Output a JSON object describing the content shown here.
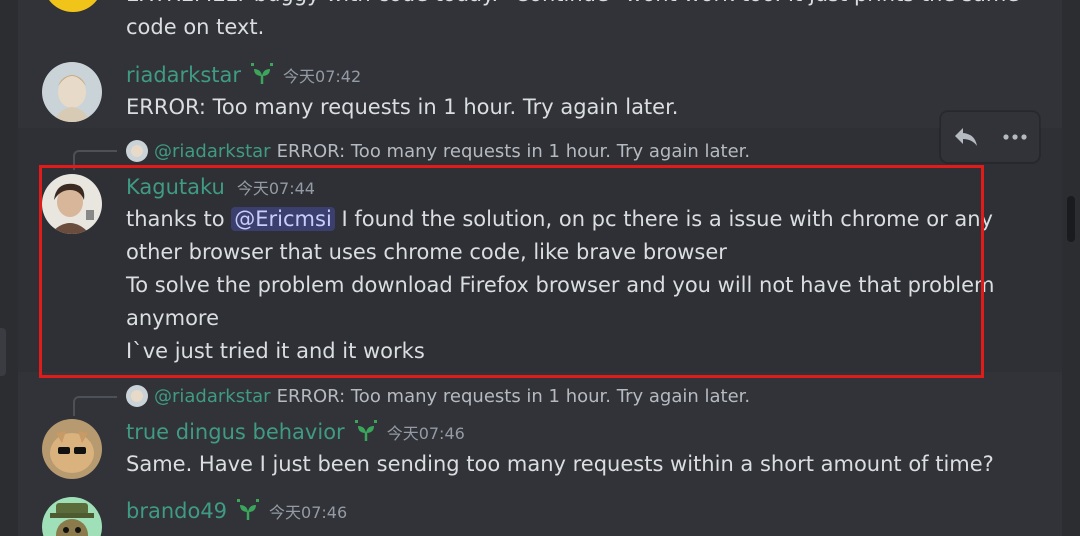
{
  "messages": [
    {
      "id": "prev-cont",
      "text_lines": [
        "EXTREMELY buggy with code today. \"Continue\" wont work too. It just prints the same",
        "code on text."
      ]
    },
    {
      "id": "riadarkstar",
      "username": "riadarkstar",
      "username_color": "#3f9b84",
      "timestamp": "今天07:42",
      "text": "ERROR: Too many requests in 1 hour. Try again later."
    },
    {
      "id": "kagutaku",
      "reply": {
        "name": "@riadarkstar",
        "text": "ERROR: Too many requests in 1 hour. Try again later."
      },
      "username": "Kagutaku",
      "username_color": "#3f9b84",
      "timestamp": "今天07:44",
      "prefix": "thanks to ",
      "mention": "@Ericmsi",
      "line1_rest": " I found the solution, on pc there is a issue with chrome or any",
      "line2": "other browser that uses chrome code, like brave browser",
      "line3": "To solve the problem download Firefox browser and you will not have that problem",
      "line4": "anymore",
      "line5": "I`ve just tried it and it works"
    },
    {
      "id": "true-dingus",
      "reply": {
        "name": "@riadarkstar",
        "text": "ERROR: Too many requests in 1 hour. Try again later."
      },
      "username": "true dingus behavior",
      "username_color": "#3f9b84",
      "timestamp": "今天07:46",
      "text": "Same. Have I just been sending too many requests within a short amount of time?"
    },
    {
      "id": "brando49",
      "username": "brando49",
      "username_color": "#3f9b84",
      "timestamp": "今天07:46"
    }
  ],
  "toolbar": {
    "reply_icon": "reply-arrow-icon",
    "more_icon": "more-dots-icon"
  },
  "colors": {
    "background": "#313338",
    "highlight_box": "#e11a1a",
    "mention_bg": "#3c4270"
  }
}
